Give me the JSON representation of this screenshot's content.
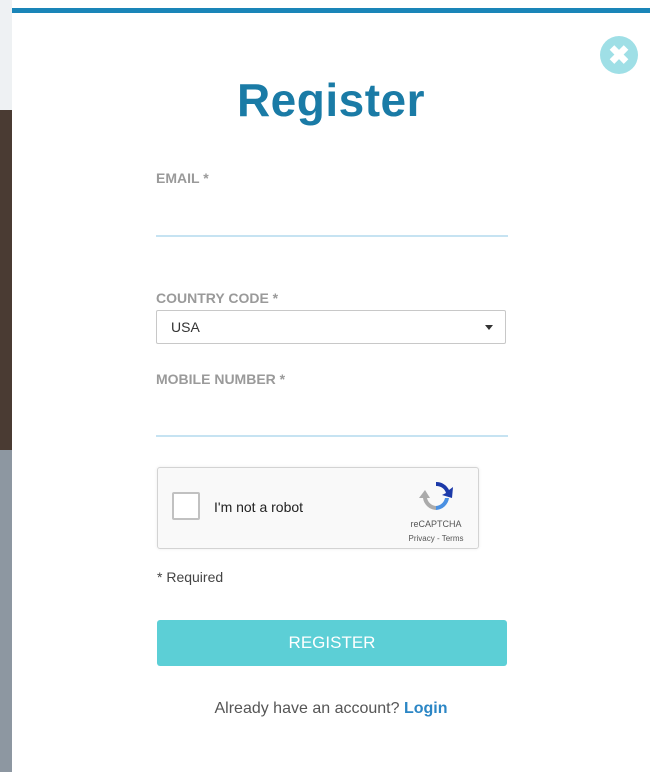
{
  "modal": {
    "close_icon": "close-circle-icon",
    "close_glyph": "✖",
    "title": "Register"
  },
  "form": {
    "email": {
      "label": "EMAIL *",
      "value": ""
    },
    "country_code": {
      "label": "COUNTRY CODE *",
      "selected": "USA"
    },
    "mobile": {
      "label": "MOBILE NUMBER *",
      "value": ""
    },
    "captcha": {
      "label": "I'm not a robot",
      "brand": "reCAPTCHA",
      "terms": "Privacy - Terms",
      "checked": false
    },
    "required_note": "* Required",
    "submit_label": "REGISTER"
  },
  "footer": {
    "prompt": "Already have an account?",
    "link_label": "Login"
  },
  "colors": {
    "accent": "#1a7ba6",
    "button": "#5ccfd6",
    "link": "#2b86c5",
    "top_border": "#1a85b8"
  }
}
